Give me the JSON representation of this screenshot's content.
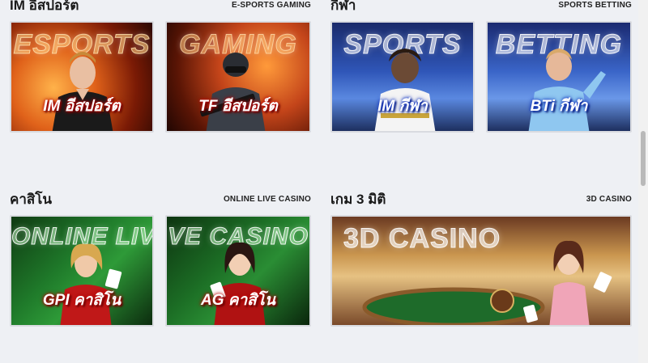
{
  "sections": [
    {
      "title": "IM อีสปอร์ต",
      "subtitle": "E-SPORTS GAMING",
      "cards": [
        {
          "bg_text": "ESPORTS",
          "label": "IM อีสปอร์ต"
        },
        {
          "bg_text": "GAMING",
          "label": "TF อีสปอร์ต"
        }
      ]
    },
    {
      "title": "กีฬา",
      "subtitle": "SPORTS BETTING",
      "cards": [
        {
          "bg_text": "SPORTS",
          "label": "IM กีฬา"
        },
        {
          "bg_text": "BETTING",
          "label": "BTi กีฬา"
        }
      ]
    },
    {
      "title": "คาสิโน",
      "subtitle": "ONLINE LIVE CASINO",
      "cards": [
        {
          "bg_text": "ONLINE LIV",
          "label": "GPI คาสิโน"
        },
        {
          "bg_text": "VE CASINO",
          "label": "AG คาสิโน"
        }
      ]
    },
    {
      "title": "เกม 3 มิติ",
      "subtitle": "3D CASINO",
      "cards": [
        {
          "bg_text": "3D CASINO",
          "label": ""
        }
      ]
    }
  ],
  "colors": {
    "page_bg": "#eef0f4",
    "esports_fire": "#e0621a",
    "sports_blue": "#2f56b8",
    "casino_green": "#1f7a2a",
    "casino3d_gold": "#c9954e"
  }
}
